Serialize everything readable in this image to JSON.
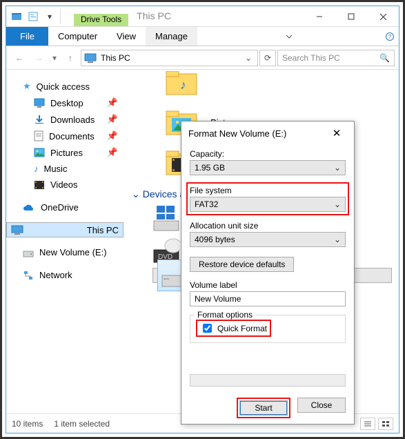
{
  "window": {
    "title": "This PC",
    "context_tab": "Drive Tools",
    "min": "–",
    "max": "□",
    "close": "×"
  },
  "ribbon": {
    "file": "File",
    "computer": "Computer",
    "view": "View",
    "manage": "Manage"
  },
  "address": {
    "path": "This PC",
    "search_placeholder": "Search This PC"
  },
  "nav": {
    "quick": "Quick access",
    "desktop": "Desktop",
    "downloads": "Downloads",
    "documents": "Documents",
    "pictures": "Pictures",
    "music": "Music",
    "videos": "Videos",
    "onedrive": "OneDrive",
    "thispc": "This PC",
    "newvol": "New Volume (E:)",
    "network": "Network"
  },
  "content": {
    "pictures": "Pictures",
    "section": "Devices and drives"
  },
  "status": {
    "items": "10 items",
    "selected": "1 item selected"
  },
  "dlg": {
    "title": "Format New Volume (E:)",
    "capacity_lbl": "Capacity:",
    "capacity": "1.95 GB",
    "fs_lbl": "File system",
    "fs": "FAT32",
    "au_lbl": "Allocation unit size",
    "au": "4096 bytes",
    "restore": "Restore device defaults",
    "vl_lbl": "Volume label",
    "vl": "New Volume",
    "fo_lbl": "Format options",
    "quick": "Quick Format",
    "start": "Start",
    "close": "Close"
  }
}
